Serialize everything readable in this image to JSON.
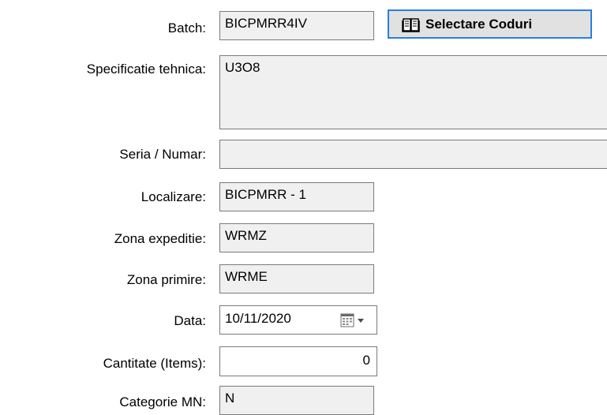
{
  "form": {
    "batch": {
      "label": "Batch:",
      "value": "BICPMRR4IV"
    },
    "select_codes_button": {
      "label": "Selectare Coduri",
      "icon": "book-icon"
    },
    "specificatie": {
      "label": "Specificatie tehnica:",
      "value": "U3O8"
    },
    "seria": {
      "label": "Seria / Numar:",
      "value": ""
    },
    "localizare": {
      "label": "Localizare:",
      "value": "BICPMRR - 1"
    },
    "zona_expeditie": {
      "label": "Zona expeditie:",
      "value": "WRMZ"
    },
    "zona_primire": {
      "label": "Zona primire:",
      "value": "WRME"
    },
    "data": {
      "label": "Data:",
      "value": "10/11/2020",
      "icon": "calendar-icon"
    },
    "cantitate": {
      "label": "Cantitate (Items):",
      "value": "0"
    },
    "categorie": {
      "label": "Categorie MN:",
      "value": "N"
    }
  },
  "colors": {
    "readonly_bg": "#f0f0f0",
    "editable_bg": "#ffffff",
    "border": "#7a7a7a",
    "button_focus_border": "#2a7de1",
    "button_bg": "#e1e1e1"
  }
}
